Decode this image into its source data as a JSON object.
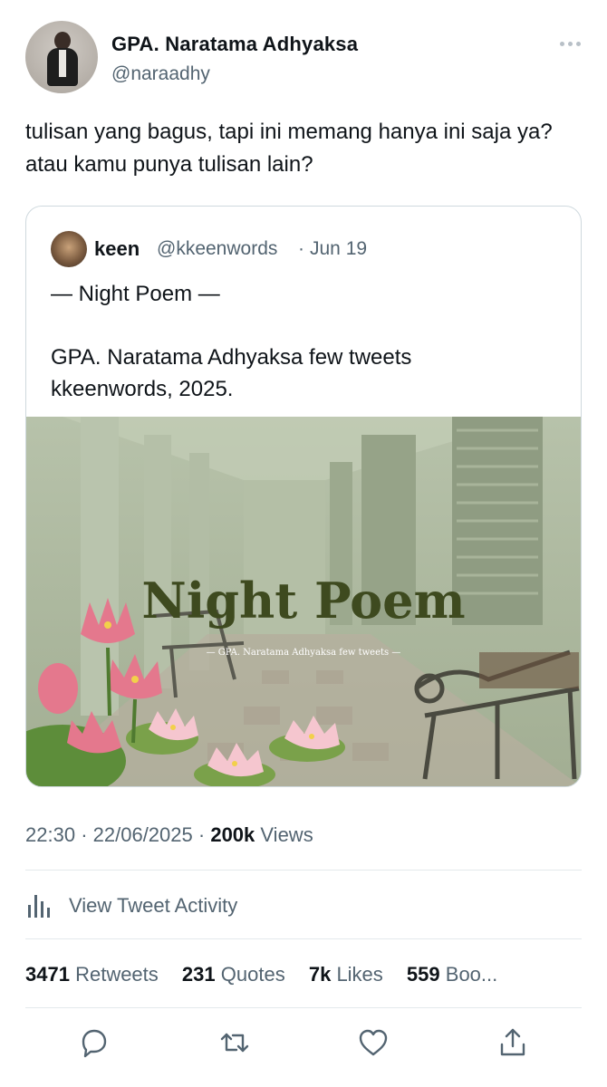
{
  "author": {
    "name": "GPA. Naratama Adhyaksa",
    "handle": "@naraadhy"
  },
  "tweet": {
    "text": "tulisan yang bagus, tapi ini memang hanya ini saja ya? atau kamu punya tulisan lain?"
  },
  "quoted": {
    "name": "keen",
    "handle": "@kkeenwords",
    "separator": "·",
    "date": "Jun 19",
    "text": "— Night Poem —\n\nGPA. Naratama Adhyaksa few tweets\nkkeenwords, 2025.",
    "image": {
      "title": "Night Poem",
      "subtitle": "— GPA. Naratama Adhyaksa few tweets —"
    }
  },
  "meta": {
    "time": "22:30",
    "separator1": "·",
    "date": "22/06/2025",
    "separator2": "·",
    "views_count": "200k",
    "views_label": "Views"
  },
  "activity": {
    "label": "View Tweet Activity",
    "icon": "analytics-icon"
  },
  "stats": {
    "retweets_count": "3471",
    "retweets_label": "Retweets",
    "quotes_count": "231",
    "quotes_label": "Quotes",
    "likes_count": "7k",
    "likes_label": "Likes",
    "bookmarks_count": "559",
    "bookmarks_label": "Boo..."
  },
  "actions": [
    "reply-icon",
    "retweet-icon",
    "like-icon",
    "share-icon"
  ],
  "colors": {
    "text": "#0f1419",
    "secondary": "#536471",
    "border": "#cfd9de",
    "poster_bg": "#aab59c",
    "poster_title": "#3e4a1f"
  }
}
